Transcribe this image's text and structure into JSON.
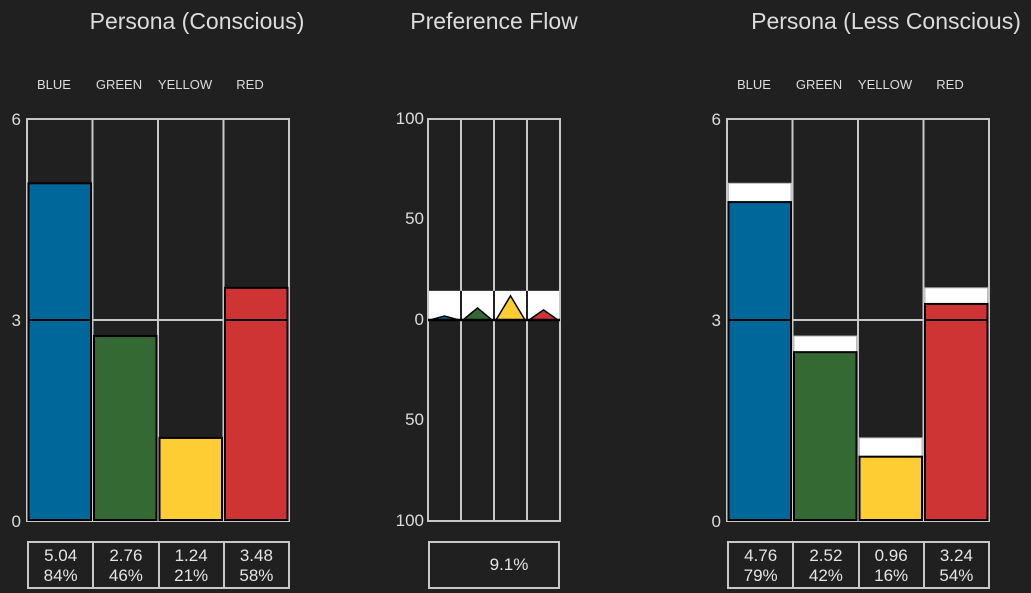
{
  "colors": {
    "blue": "#00679a",
    "green": "#356934",
    "yellow": "#fecc33",
    "red": "#cf3435",
    "background": "#202020",
    "frame": "#c8c8c8",
    "band": "#ffffff"
  },
  "chart_data": [
    {
      "type": "bar",
      "title": "Persona (Conscious)",
      "categories": [
        "BLUE",
        "GREEN",
        "YELLOW",
        "RED"
      ],
      "values": [
        5.04,
        2.76,
        1.24,
        3.48
      ],
      "percentages": [
        "84%",
        "46%",
        "21%",
        "58%"
      ],
      "value_labels": [
        "5.04",
        "2.76",
        "1.24",
        "3.48"
      ],
      "ylim": [
        0,
        6
      ],
      "yticks": [
        "6",
        "3",
        "0"
      ],
      "reference_line": 3,
      "grid": false
    },
    {
      "type": "bar",
      "title": "Preference Flow",
      "categories": [
        "BLUE",
        "GREEN",
        "YELLOW",
        "RED"
      ],
      "values": [
        2,
        6,
        12,
        5
      ],
      "band": 14.5,
      "ylim": [
        -100,
        100
      ],
      "yticks": [
        "100",
        "50",
        "0",
        "50",
        "100"
      ],
      "summary": "9.1%",
      "grid": false
    },
    {
      "type": "bar",
      "title": "Persona (Less Conscious)",
      "categories": [
        "BLUE",
        "GREEN",
        "YELLOW",
        "RED"
      ],
      "values": [
        4.76,
        2.52,
        0.96,
        3.24
      ],
      "reference_values": [
        5.04,
        2.76,
        1.24,
        3.48
      ],
      "percentages": [
        "79%",
        "42%",
        "16%",
        "54%"
      ],
      "value_labels": [
        "4.76",
        "2.52",
        "0.96",
        "3.24"
      ],
      "ylim": [
        0,
        6
      ],
      "yticks": [
        "6",
        "3",
        "0"
      ],
      "reference_line": 3,
      "grid": false
    }
  ]
}
